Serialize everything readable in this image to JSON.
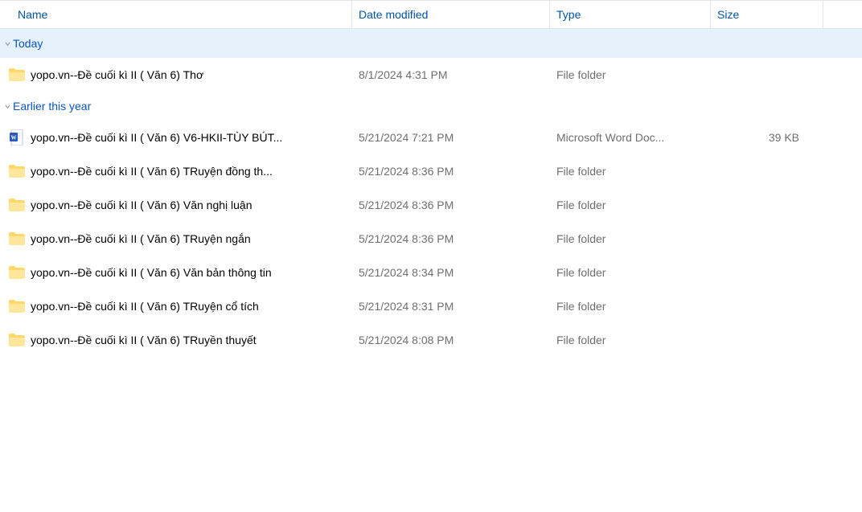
{
  "columns": {
    "name": "Name",
    "date": "Date modified",
    "type": "Type",
    "size": "Size"
  },
  "groups": [
    {
      "label": "Today",
      "selected": true,
      "items": [
        {
          "icon": "folder",
          "name": "yopo.vn--Đề cuối kì II ( Văn 6) Thơ",
          "date": "8/1/2024 4:31 PM",
          "type": "File folder",
          "size": ""
        }
      ]
    },
    {
      "label": "Earlier this year",
      "selected": false,
      "items": [
        {
          "icon": "word",
          "name": "yopo.vn--Đề cuối kì II ( Văn 6) V6-HKII-TÙY BÚT...",
          "date": "5/21/2024 7:21 PM",
          "type": "Microsoft Word Doc...",
          "size": "39 KB"
        },
        {
          "icon": "folder",
          "name": "yopo.vn--Đề cuối kì II ( Văn 6) TRuyện đồng th...",
          "date": "5/21/2024 8:36 PM",
          "type": "File folder",
          "size": ""
        },
        {
          "icon": "folder",
          "name": "yopo.vn--Đề cuối kì II ( Văn 6) Văn nghị luận",
          "date": "5/21/2024 8:36 PM",
          "type": "File folder",
          "size": ""
        },
        {
          "icon": "folder",
          "name": "yopo.vn--Đề cuối kì II ( Văn 6) TRuyện ngắn",
          "date": "5/21/2024 8:36 PM",
          "type": "File folder",
          "size": ""
        },
        {
          "icon": "folder",
          "name": "yopo.vn--Đề cuối kì II ( Văn 6) Văn bản thông tin",
          "date": "5/21/2024 8:34 PM",
          "type": "File folder",
          "size": ""
        },
        {
          "icon": "folder",
          "name": "yopo.vn--Đề cuối kì II ( Văn 6) TRuyện cổ tích",
          "date": "5/21/2024 8:31 PM",
          "type": "File folder",
          "size": ""
        },
        {
          "icon": "folder",
          "name": "yopo.vn--Đề cuối kì II ( Văn 6) TRuyền thuyết",
          "date": "5/21/2024 8:08 PM",
          "type": "File folder",
          "size": ""
        }
      ]
    }
  ]
}
